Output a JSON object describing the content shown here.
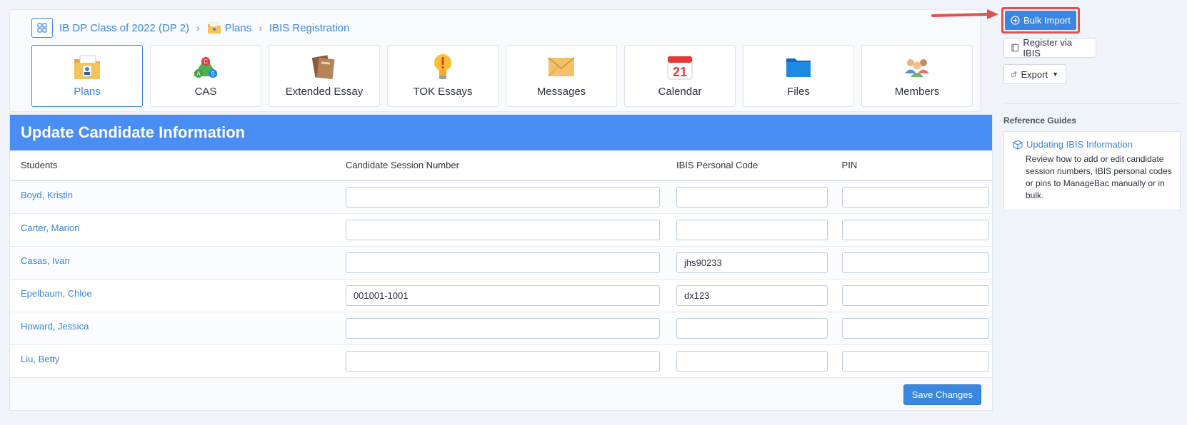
{
  "breadcrumb": {
    "class_name": "IB DP Class of 2022 (DP 2)",
    "plans": "Plans",
    "current": "IBIS Registration"
  },
  "tiles": [
    {
      "label": "Plans",
      "icon": "plans-icon",
      "active": true
    },
    {
      "label": "CAS",
      "icon": "cas-icon"
    },
    {
      "label": "Extended Essay",
      "icon": "extended-essay-icon"
    },
    {
      "label": "TOK Essays",
      "icon": "tok-essays-icon"
    },
    {
      "label": "Messages",
      "icon": "messages-icon"
    },
    {
      "label": "Calendar",
      "icon": "calendar-icon",
      "calendar_day": "21"
    },
    {
      "label": "Files",
      "icon": "files-icon"
    },
    {
      "label": "Members",
      "icon": "members-icon"
    }
  ],
  "form": {
    "title": "Update Candidate Information",
    "columns": [
      "Students",
      "Candidate Session Number",
      "IBIS Personal Code",
      "PIN"
    ],
    "rows": [
      {
        "student": "Boyd, Kristin",
        "session": "",
        "ibis_code": "",
        "pin": ""
      },
      {
        "student": "Carter, Marion",
        "session": "",
        "ibis_code": "",
        "pin": ""
      },
      {
        "student": "Casas, Ivan",
        "session": "",
        "ibis_code": "jhs90233",
        "pin": ""
      },
      {
        "student": "Epelbaum, Chloe",
        "session": "001001-1001",
        "ibis_code": "dx123",
        "pin": ""
      },
      {
        "student": "Howard, Jessica",
        "session": "",
        "ibis_code": "",
        "pin": ""
      },
      {
        "student": "Liu, Betty",
        "session": "",
        "ibis_code": "",
        "pin": ""
      }
    ],
    "save_label": "Save Changes"
  },
  "sidebar": {
    "bulk_import": "Bulk Import",
    "register_ibis": "Register via IBIS",
    "export": "Export",
    "reference_title": "Reference Guides",
    "guide_title": "Updating IBIS Information",
    "guide_desc": "Review how to add or edit candidate session numbers, IBIS personal codes or pins to ManageBac manually or in bulk."
  },
  "colors": {
    "accent": "#3a86e0",
    "header": "#4a8ef5",
    "highlight": "#e2504b"
  }
}
